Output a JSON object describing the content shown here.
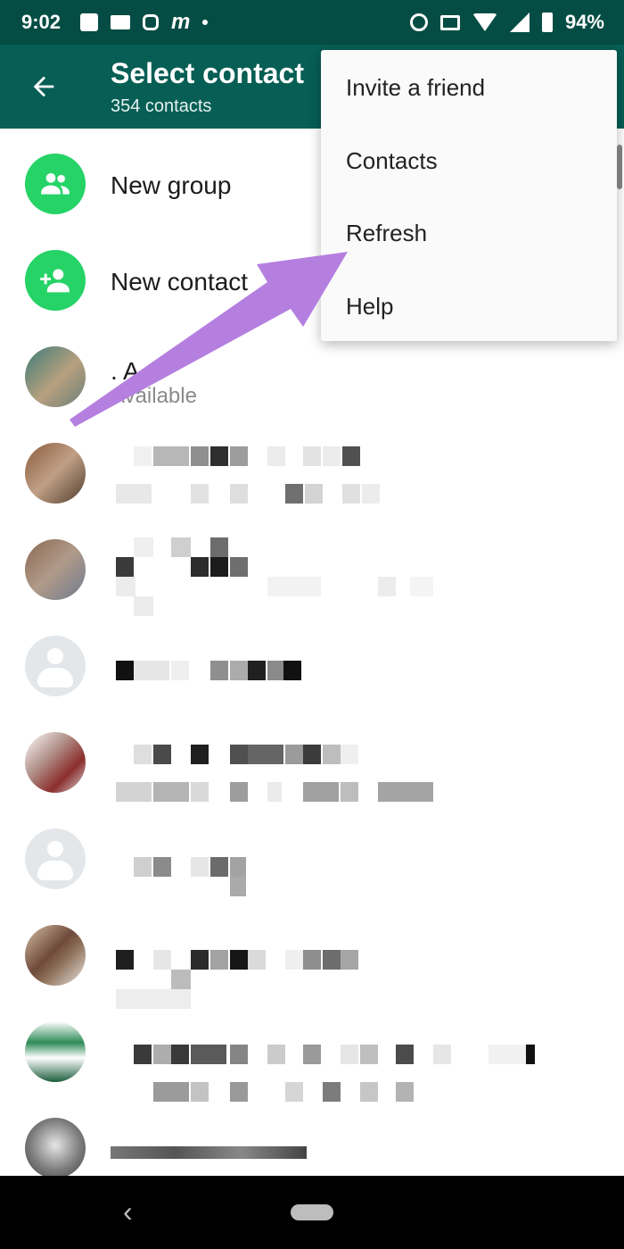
{
  "status_bar": {
    "time": "9:02",
    "battery": "94%",
    "icons_left": [
      "facebook-icon",
      "mail-icon",
      "instagram-icon",
      "m-logo",
      "dot"
    ],
    "icons_right": [
      "alarm-icon",
      "cast-icon",
      "wifi-icon",
      "signal-icon",
      "battery-icon"
    ]
  },
  "header": {
    "title": "Select contact",
    "subtitle": "354 contacts",
    "back_icon": "arrow-left-icon",
    "bg_color": "#075e54"
  },
  "menu": {
    "items": [
      "Invite a friend",
      "Contacts",
      "Refresh",
      "Help"
    ]
  },
  "actions": [
    {
      "label": "New group",
      "icon": "group-icon"
    },
    {
      "label": "New contact",
      "icon": "add-contact-icon"
    }
  ],
  "contacts": [
    {
      "name": ". A",
      "status": "Available"
    }
  ],
  "accent_color": "#25d366",
  "annotation_arrow_color": "#b57fe0"
}
